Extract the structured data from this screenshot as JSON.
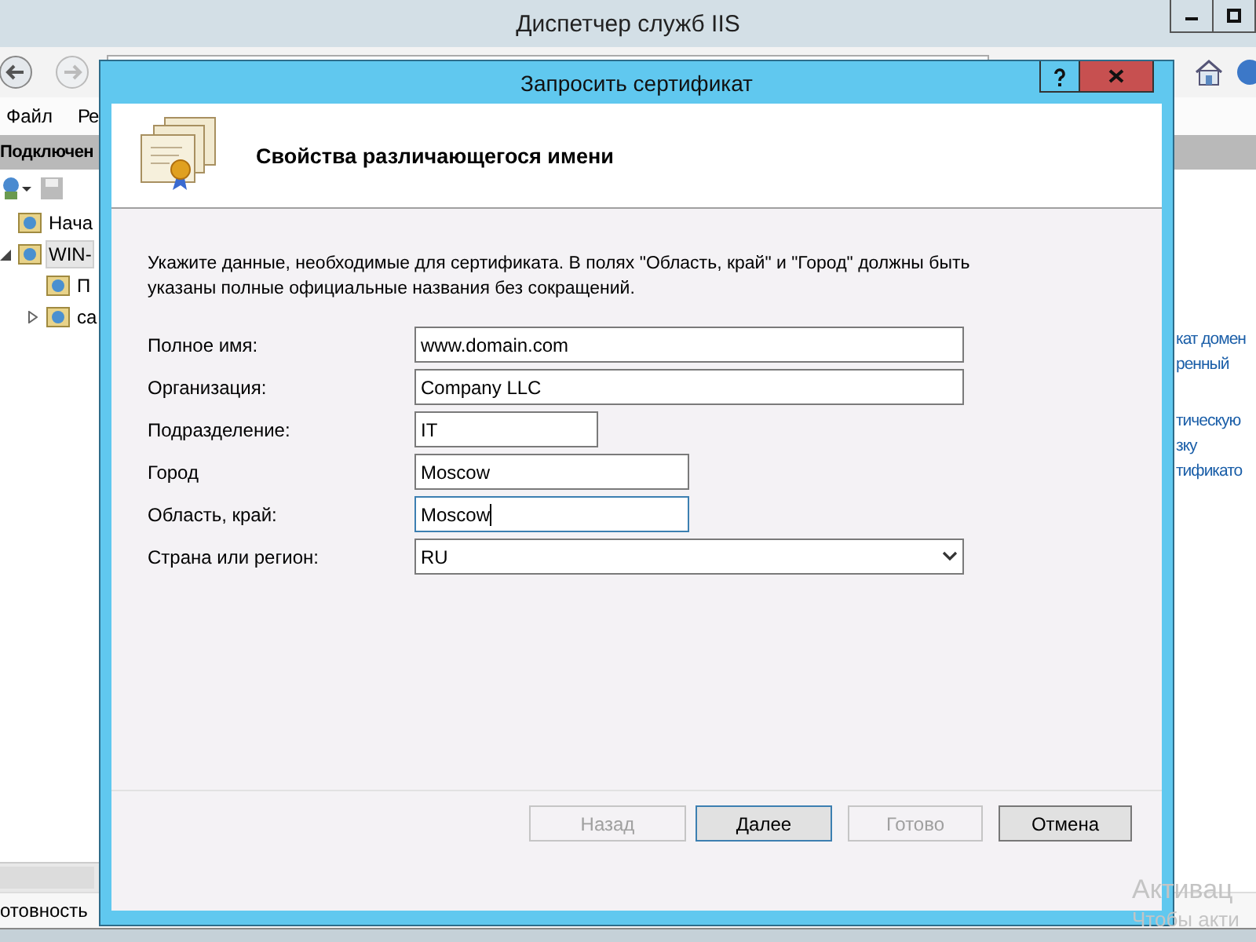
{
  "background_window": {
    "title": "Диспетчер служб IIS",
    "menu": [
      "Файл",
      "Ре"
    ],
    "connections_header": "Подключен",
    "tree": [
      {
        "label": "Нача",
        "selected": false
      },
      {
        "label": "WIN-",
        "selected": true,
        "expanded": true,
        "children": [
          {
            "label": "П",
            "selected": false
          },
          {
            "label": "са",
            "selected": false,
            "expanded": false
          }
        ]
      }
    ],
    "actions": [
      "кат домен",
      "ренный",
      "тическую",
      "зку",
      "тификато"
    ],
    "status_bar": "отовность"
  },
  "activation_notice": [
    "Активац",
    "Чтобы акти"
  ],
  "dialog": {
    "title": "Запросить сертификат",
    "heading": "Свойства различающегося имени",
    "intro": "Укажите данные, необходимые для сертификата. В полях \"Область, край\" и \"Город\" должны быть указаны полные официальные названия без сокращений.",
    "fields": [
      {
        "label": "Полное имя:",
        "kind": "text",
        "value": "www.domain.com",
        "focused": false
      },
      {
        "label": "Организация:",
        "kind": "text",
        "value": "Company LLC",
        "focused": false
      },
      {
        "label": "Подразделение:",
        "kind": "text",
        "value": "IT",
        "focused": false
      },
      {
        "label": "Город",
        "kind": "text",
        "value": "Moscow",
        "focused": false
      },
      {
        "label": "Область, край:",
        "kind": "text",
        "value": "Moscow",
        "focused": true
      },
      {
        "label": "Страна или регион:",
        "kind": "dropdown",
        "value": "RU",
        "focused": false
      }
    ],
    "buttons": [
      {
        "label": "Назад",
        "disabled": true,
        "default": false
      },
      {
        "label": "Далее",
        "disabled": false,
        "default": true
      },
      {
        "label": "Готово",
        "disabled": true,
        "default": false
      },
      {
        "label": "Отмена",
        "disabled": false,
        "default": false
      }
    ]
  }
}
